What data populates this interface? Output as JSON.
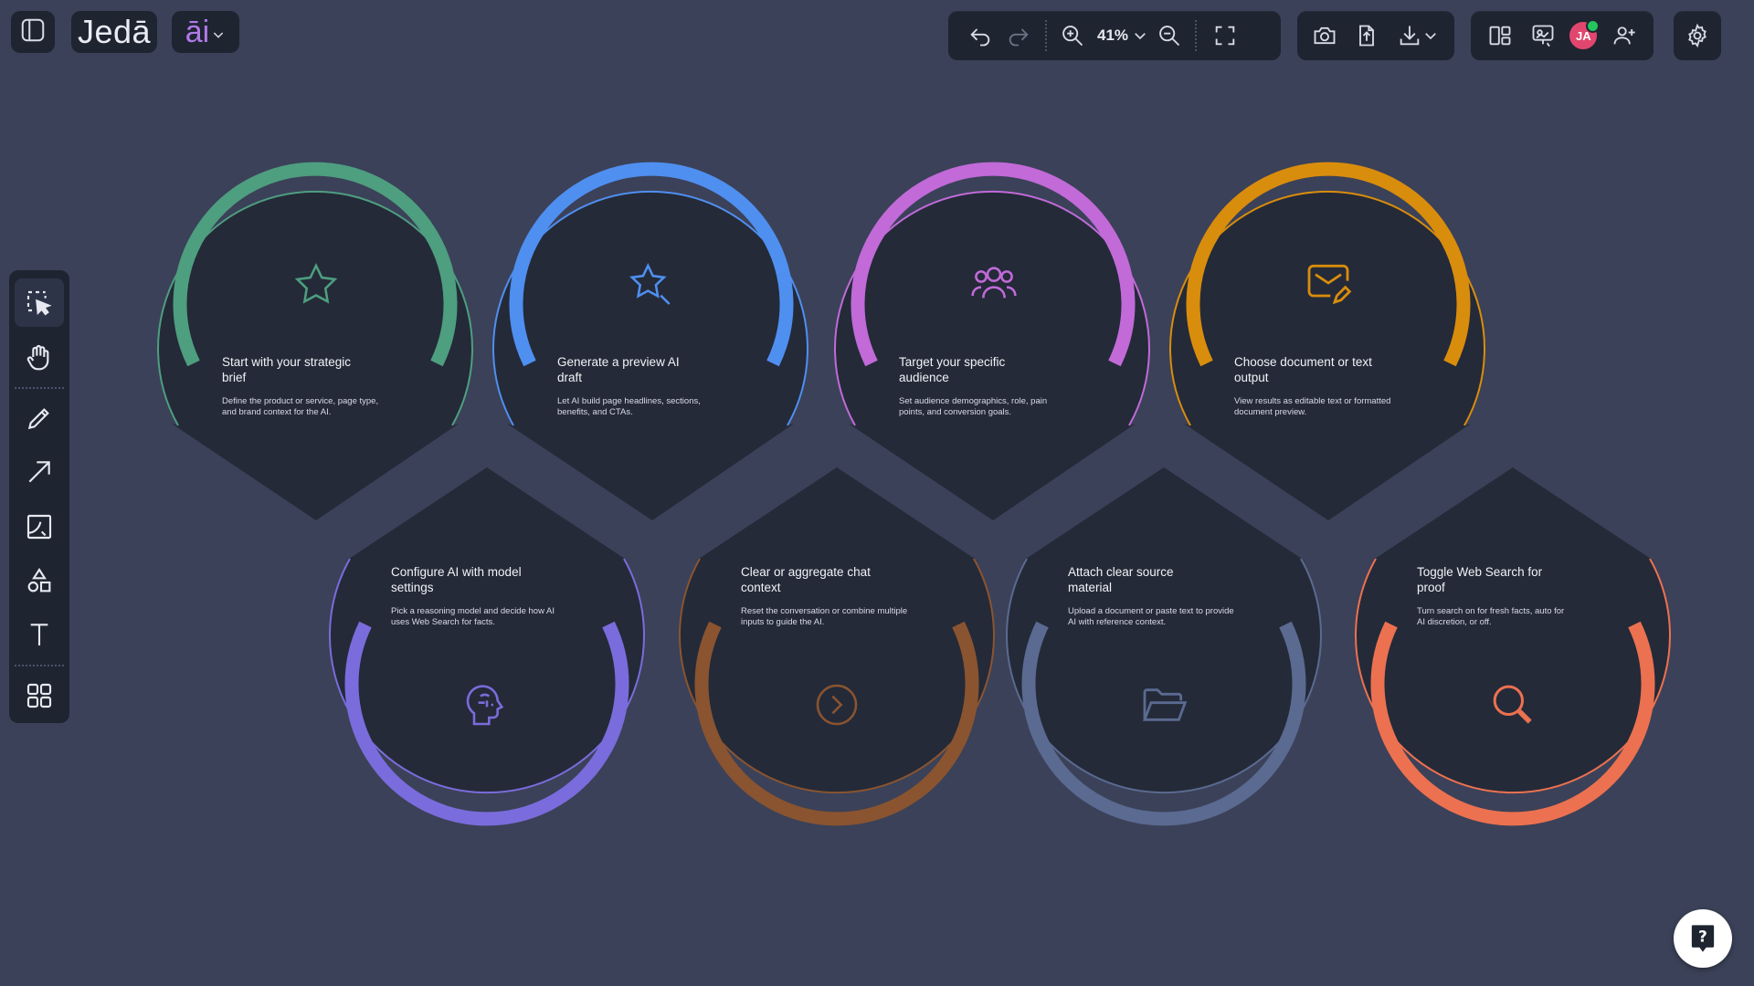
{
  "app": {
    "logo": "Jedā",
    "ai_label": "āi"
  },
  "toolbar": {
    "zoom": "41%"
  },
  "user": {
    "initials": "JA"
  },
  "cards": [
    {
      "title_l1": "Start with your strategic",
      "title_l2": "brief",
      "desc_l1": "Define the product or service, page type,",
      "desc_l2": "and brand context for the AI.",
      "icon": "star-icon",
      "color": "#4e9e80"
    },
    {
      "title_l1": "Generate a preview AI",
      "title_l2": "draft",
      "desc_l1": "Let AI build page headlines, sections,",
      "desc_l2": "benefits, and CTAs.",
      "icon": "sparkle-star-icon",
      "color": "#4f8ff0"
    },
    {
      "title_l1": "Target your specific",
      "title_l2": "audience",
      "desc_l1": "Set audience demographics, role, pain",
      "desc_l2": "points, and conversion goals.",
      "icon": "users-icon",
      "color": "#c16ad8"
    },
    {
      "title_l1": "Choose document or text",
      "title_l2": "output",
      "desc_l1": "View results as editable text or formatted",
      "desc_l2": "document preview.",
      "icon": "envelope-edit-icon",
      "color": "#d98d0c"
    },
    {
      "title_l1": "Configure AI with model",
      "title_l2": "settings",
      "desc_l1": "Pick a reasoning model and decide how AI",
      "desc_l2": "uses Web Search for facts.",
      "icon": "brain-icon",
      "color": "#7a6cdc"
    },
    {
      "title_l1": "Clear or aggregate chat",
      "title_l2": "context",
      "desc_l1": "Reset the conversation or combine multiple",
      "desc_l2": "inputs to guide the AI.",
      "icon": "chevron-circle-icon",
      "color": "#8a5430"
    },
    {
      "title_l1": "Attach clear source",
      "title_l2": "material",
      "desc_l1": "Upload a document or paste text to provide",
      "desc_l2": "AI with reference context.",
      "icon": "folder-icon",
      "color": "#5a6a90"
    },
    {
      "title_l1": "Toggle Web Search for",
      "title_l2": "proof",
      "desc_l1": "Turn search on for fresh facts, auto for",
      "desc_l2": "AI discretion, or off.",
      "icon": "search-icon",
      "color": "#ec7150"
    }
  ]
}
